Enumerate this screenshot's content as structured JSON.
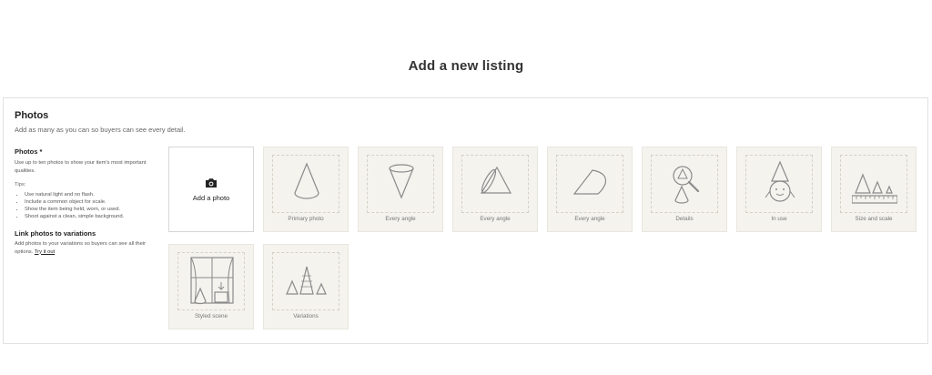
{
  "page": {
    "title": "Add a new listing"
  },
  "photos_section": {
    "title": "Photos",
    "subtitle": "Add as many as you can so buyers can see every detail."
  },
  "left_column": {
    "heading": "Photos *",
    "description": "Use up to ten photos to show your item's most important qualities.",
    "tips_label": "Tips:",
    "tips": [
      "Use natural light and no flash.",
      "Include a common object for scale.",
      "Show the item being held, worn, or used.",
      "Shoot against a clean, simple background."
    ],
    "variations_heading": "Link photos to variations",
    "variations_text": "Add photos to your variations so buyers can see all their options.",
    "try_link": "Try it out"
  },
  "add_photo": {
    "label": "Add a photo",
    "icon": "camera-icon"
  },
  "slots": [
    {
      "caption": "Primary photo",
      "icon": "cone-icon"
    },
    {
      "caption": "Every angle",
      "icon": "inverted-cone-icon"
    },
    {
      "caption": "Every angle",
      "icon": "tilted-cone-icon"
    },
    {
      "caption": "Every angle",
      "icon": "side-cone-icon"
    },
    {
      "caption": "Details",
      "icon": "magnifier-cone-icon"
    },
    {
      "caption": "In use",
      "icon": "cone-character-icon"
    },
    {
      "caption": "Size and scale",
      "icon": "cones-ruler-icon"
    },
    {
      "caption": "Styled scene",
      "icon": "window-scene-icon"
    },
    {
      "caption": "Variations",
      "icon": "cone-variations-icon"
    }
  ]
}
